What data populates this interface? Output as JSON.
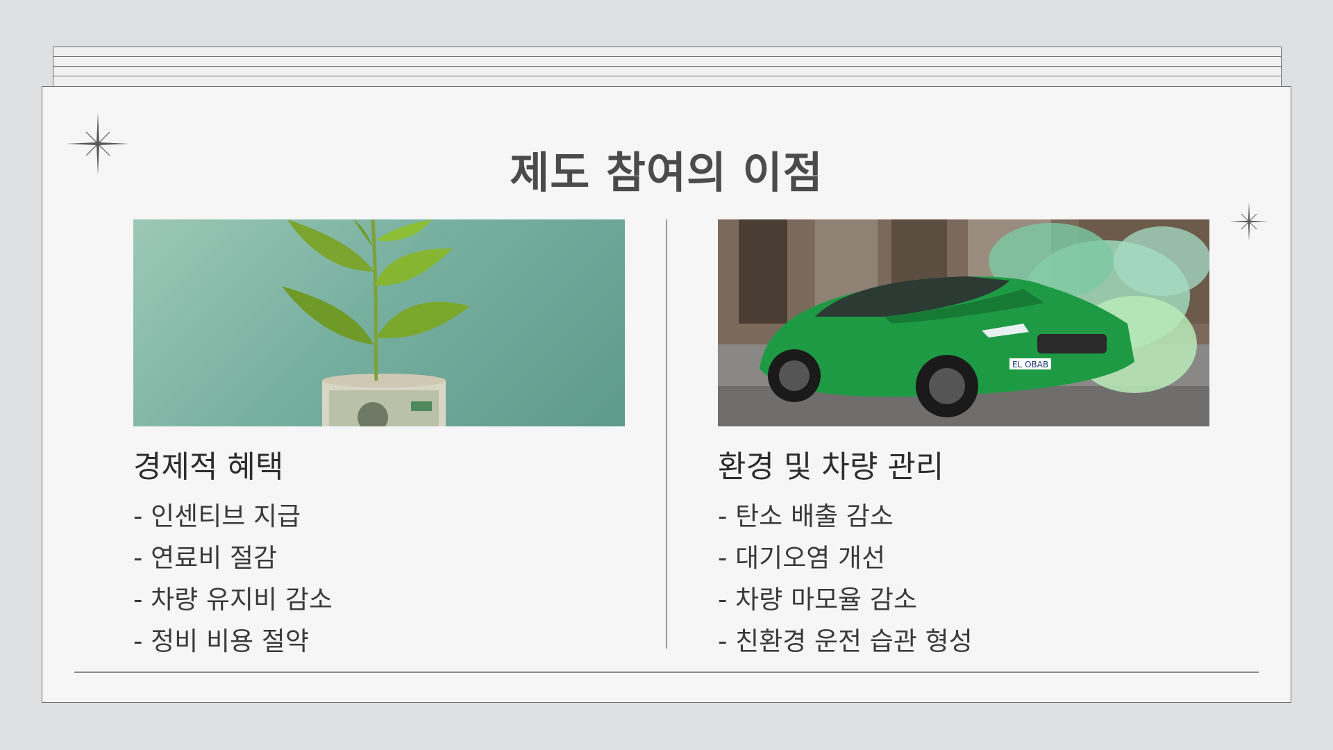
{
  "slide": {
    "title": "제도 참여의 이점",
    "left": {
      "heading": "경제적 혜택",
      "items": [
        "- 인센티브 지급",
        "- 연료비 절감",
        "- 차량 유지비 감소",
        "- 정비 비용 절약"
      ],
      "image": "plant-growing-from-money-roll"
    },
    "right": {
      "heading": "환경 및 차량 관리",
      "items": [
        "- 탄소 배출 감소",
        "- 대기오염 개선",
        "- 차량 마모율 감소",
        "- 친환경 운전 습관 형성"
      ],
      "image": "green-car-with-smoke",
      "plate_text": "EL OBAB"
    }
  },
  "colors": {
    "background": "#dfe0e2",
    "card": "#f6f6f6",
    "title": "#4b4b4b",
    "car": "#1f9a44"
  }
}
